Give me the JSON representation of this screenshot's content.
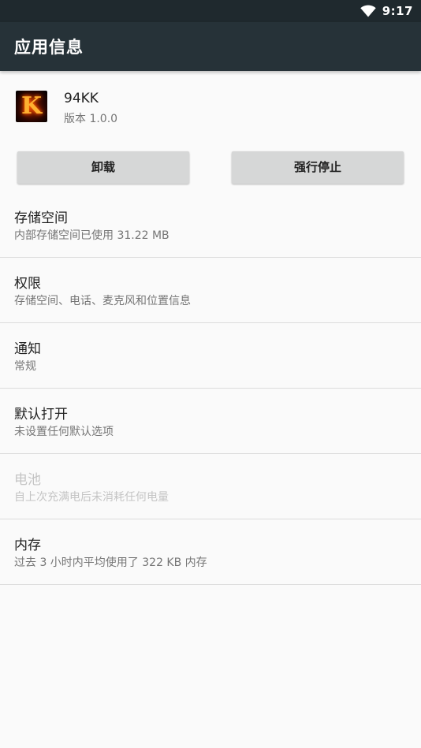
{
  "status_bar": {
    "time": "9:17",
    "icons": [
      "wifi-icon"
    ]
  },
  "app_bar": {
    "title": "应用信息"
  },
  "app": {
    "icon": "app-icon",
    "icon_letter": "K",
    "name": "94KK",
    "version": "版本 1.0.0"
  },
  "buttons": {
    "uninstall": "卸载",
    "force_stop": "强行停止"
  },
  "items": [
    {
      "title": "存储空间",
      "subtitle": "内部存储空间已使用 31.22 MB",
      "enabled": true
    },
    {
      "title": "权限",
      "subtitle": "存储空间、电话、麦克风和位置信息",
      "enabled": true
    },
    {
      "title": "通知",
      "subtitle": "常规",
      "enabled": true
    },
    {
      "title": "默认打开",
      "subtitle": "未设置任何默认选项",
      "enabled": true
    },
    {
      "title": "电池",
      "subtitle": "自上次充满电后未消耗任何电量",
      "enabled": false
    },
    {
      "title": "内存",
      "subtitle": "过去 3 小时内平均使用了 322 KB 内存",
      "enabled": true
    }
  ],
  "colors": {
    "status_bar": "#1f292e",
    "app_bar": "#263238",
    "background": "#fafafa",
    "button": "#d6d7d7",
    "disabled_text": "#c4c4c4"
  }
}
